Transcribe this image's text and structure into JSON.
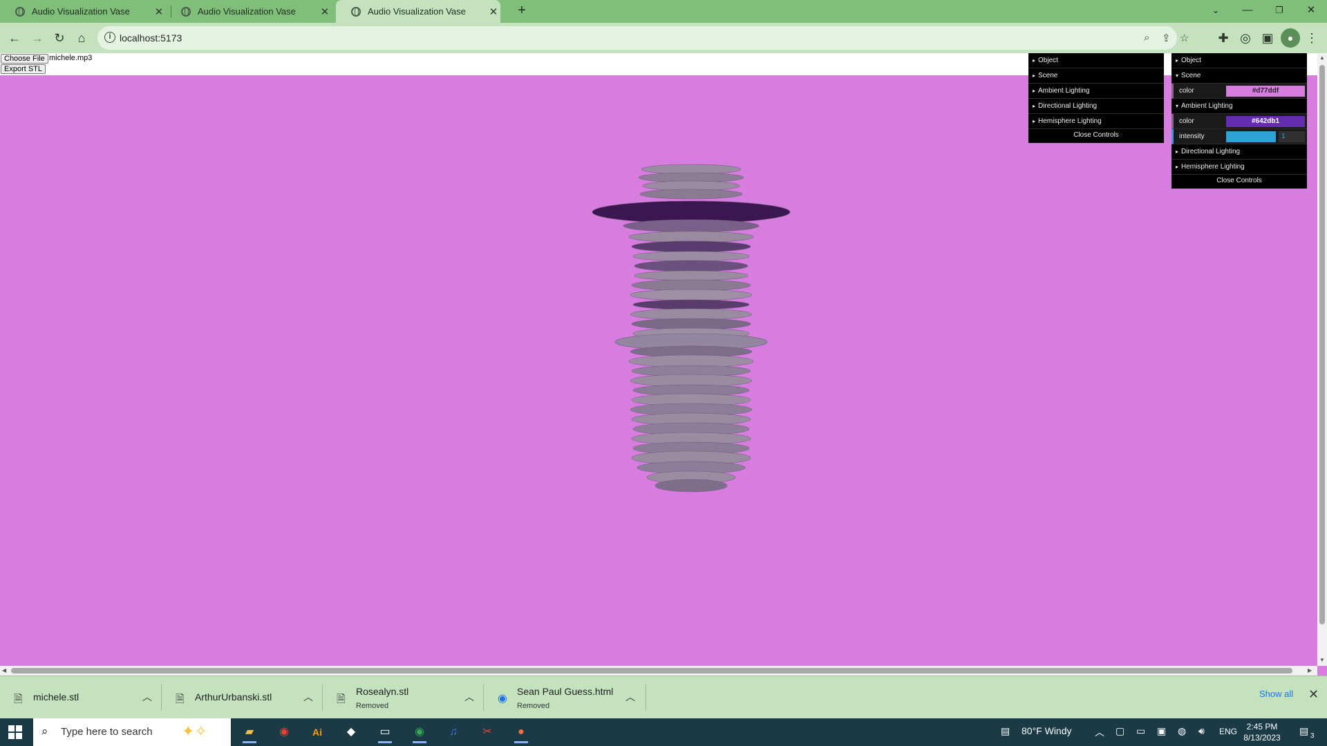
{
  "browser": {
    "tabs": [
      {
        "title": "Audio Visualization Vase",
        "active": false
      },
      {
        "title": "Audio Visualization Vase",
        "active": false
      },
      {
        "title": "Audio Visualization Vase",
        "active": true
      }
    ],
    "new_tab_label": "+",
    "url": "localhost:5173"
  },
  "page": {
    "choose_file_label": "Choose File",
    "file_name": "michele.mp3",
    "export_label": "Export STL",
    "background_color": "#d77ddf"
  },
  "gui_left": {
    "folders": [
      "Object",
      "Scene",
      "Ambient Lighting",
      "Directional Lighting",
      "Hemisphere Lighting"
    ],
    "close_label": "Close Controls"
  },
  "gui_right": {
    "object_label": "Object",
    "scene_label": "Scene",
    "scene_color_label": "color",
    "scene_color_value": "#d77ddf",
    "ambient_label": "Ambient Lighting",
    "ambient_color_label": "color",
    "ambient_color_value": "#642db1",
    "intensity_label": "intensity",
    "intensity_value": "1",
    "directional_label": "Directional Lighting",
    "hemisphere_label": "Hemisphere Lighting",
    "close_label": "Close Controls"
  },
  "downloads": [
    {
      "name": "michele.stl",
      "status": "",
      "icon": "file-icon"
    },
    {
      "name": "ArthurUrbanski.stl",
      "status": "",
      "icon": "file-icon"
    },
    {
      "name": "Rosealyn.stl",
      "status": "Removed",
      "icon": "file-icon"
    },
    {
      "name": "Sean Paul Guess.html",
      "status": "Removed",
      "icon": "chrome-icon"
    }
  ],
  "show_all_label": "Show all",
  "taskbar": {
    "search_placeholder": "Type here to search",
    "weather": "80°F  Windy",
    "language": "ENG",
    "time": "2:45 PM",
    "date": "8/13/2023",
    "notifications": "3"
  }
}
